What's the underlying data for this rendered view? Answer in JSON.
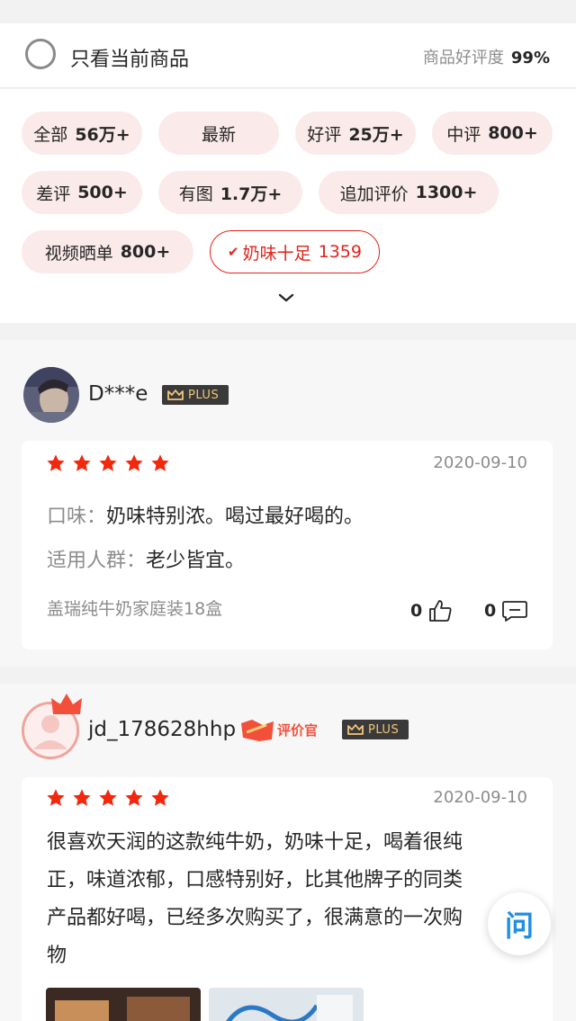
{
  "filter": {
    "only_current_label": "只看当前商品",
    "rating_label": "商品好评度",
    "rating_value": "99%"
  },
  "tags": [
    {
      "label": "全部",
      "count": "56万+",
      "selected": false
    },
    {
      "label": "最新",
      "count": "",
      "selected": false
    },
    {
      "label": "好评",
      "count": "25万+",
      "selected": false
    },
    {
      "label": "中评",
      "count": "800+",
      "selected": false
    },
    {
      "label": "差评",
      "count": "500+",
      "selected": false
    },
    {
      "label": "有图",
      "count": "1.7万+",
      "selected": false
    },
    {
      "label": "追加评价",
      "count": "1300+",
      "selected": false
    },
    {
      "label": "视频晒单",
      "count": "800+",
      "selected": false
    },
    {
      "label": "奶味十足",
      "count": "1359",
      "selected": true
    }
  ],
  "reviews": [
    {
      "username": "D***e",
      "plus_badge": "PLUS",
      "rating": 5,
      "date": "2020-09-10",
      "lines": [
        {
          "label": "口味：",
          "value": "奶味特别浓。喝过最好喝的。"
        },
        {
          "label": "适用人群：",
          "value": "老少皆宜。"
        }
      ],
      "product": "盖瑞纯牛奶家庭装18盒",
      "likes": "0",
      "comments": "0"
    },
    {
      "username": "jd_178628hhp",
      "reviewer_badge": "评价官",
      "plus_badge": "PLUS",
      "rating": 5,
      "date": "2020-09-10",
      "text_lines": [
        "很喜欢天润的这款纯牛奶，奶味十足，喝着很纯",
        "正，味道浓郁，口感特别好，比其他牌子的同类",
        "产品都好喝，已经多次购买了，很满意的一次购",
        "物"
      ]
    }
  ],
  "float_button": {
    "label": "问"
  },
  "colors": {
    "accent": "#e2231a",
    "tag_bg": "#fbeaea",
    "star": "#f2270c",
    "muted": "#8c8c8c"
  }
}
